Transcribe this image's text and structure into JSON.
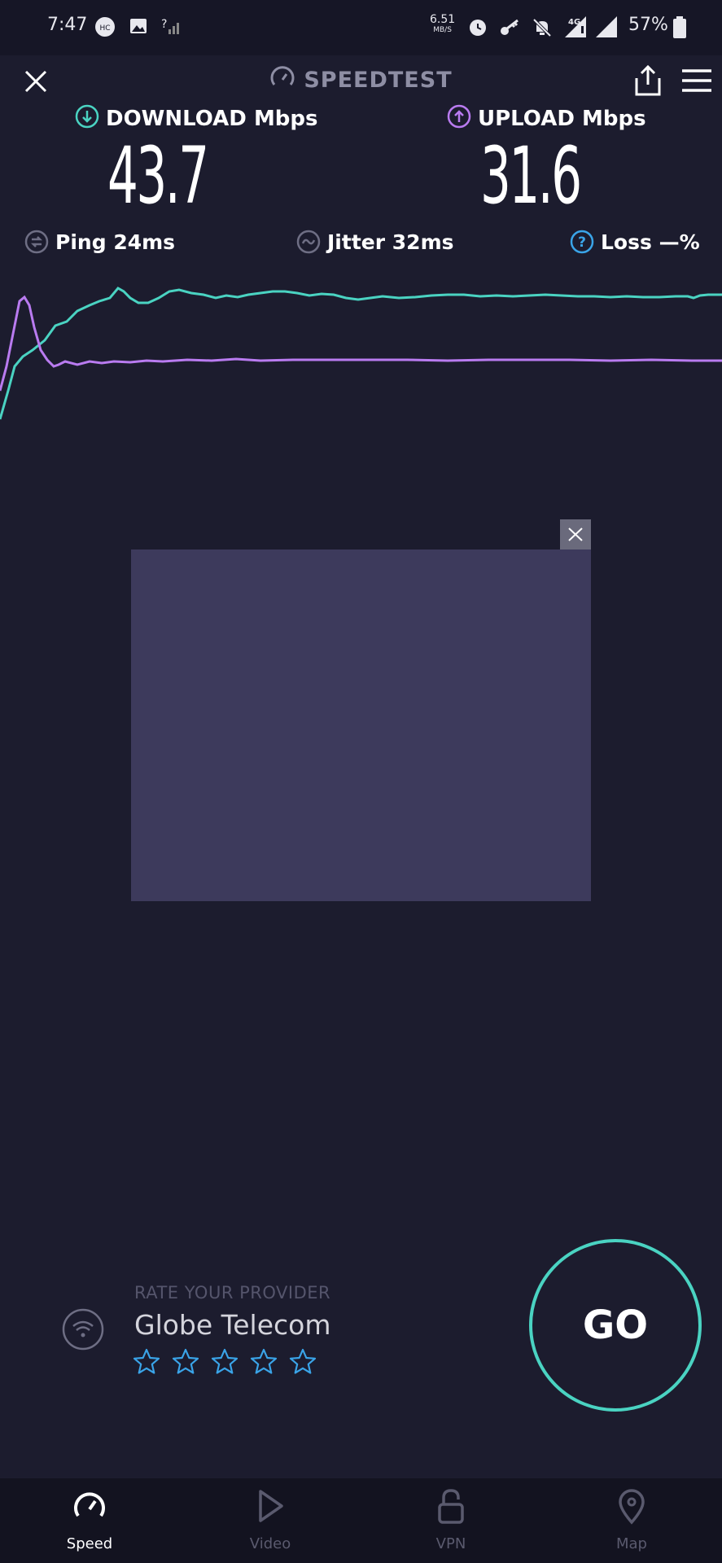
{
  "status_bar": {
    "time": "7:47",
    "net_speed_value": "6.51",
    "net_speed_unit": "MB/S",
    "network_type": "4G",
    "battery": "57%"
  },
  "header": {
    "title": "SPEEDTEST"
  },
  "results": {
    "download_label": "DOWNLOAD",
    "download_unit": "Mbps",
    "download_value": "43.7",
    "upload_label": "UPLOAD",
    "upload_unit": "Mbps",
    "upload_value": "31.6",
    "ping_label": "Ping",
    "ping_value": "24ms",
    "jitter_label": "Jitter",
    "jitter_value": "32ms",
    "loss_label": "Loss",
    "loss_value": "—%"
  },
  "colors": {
    "download": "#4ad3c2",
    "upload": "#b97bf0",
    "background": "#1c1c2e",
    "ad_placeholder": "#3d3a5c",
    "star": "#3aa4e8"
  },
  "provider": {
    "rate_label": "RATE YOUR PROVIDER",
    "name": "Globe Telecom",
    "rating": 0,
    "max_rating": 5
  },
  "go_button": {
    "label": "GO"
  },
  "nav": {
    "items": [
      {
        "label": "Speed",
        "icon": "speedometer-icon",
        "active": true
      },
      {
        "label": "Video",
        "icon": "play-icon",
        "active": false
      },
      {
        "label": "VPN",
        "icon": "unlock-icon",
        "active": false
      },
      {
        "label": "Map",
        "icon": "map-pin-icon",
        "active": false
      }
    ]
  }
}
